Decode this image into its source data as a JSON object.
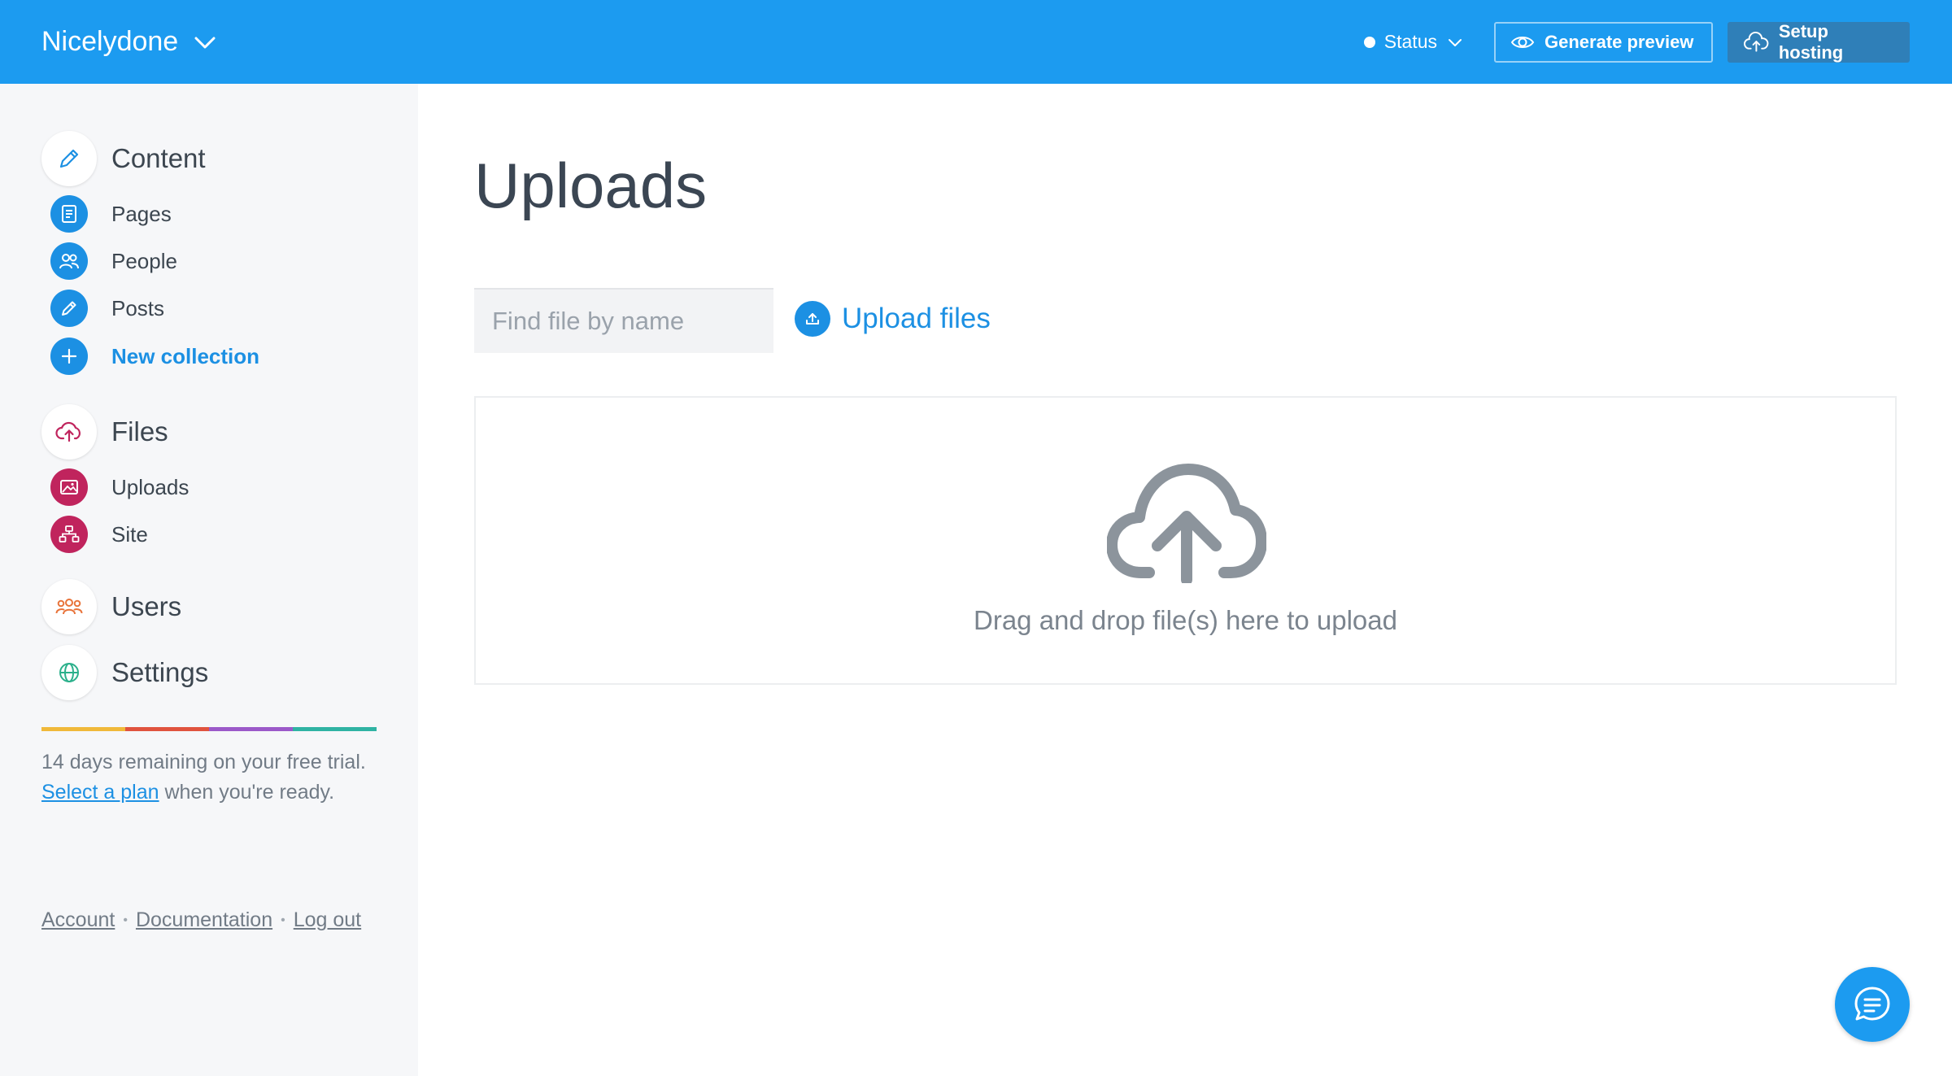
{
  "header": {
    "site_name": "Nicelydone",
    "status_label": "Status",
    "preview_label": "Generate preview",
    "hosting_label": "Setup hosting"
  },
  "sidebar": {
    "content": {
      "label": "Content",
      "items": [
        {
          "label": "Pages",
          "icon": "page-icon"
        },
        {
          "label": "People",
          "icon": "people-icon"
        },
        {
          "label": "Posts",
          "icon": "pencil-icon"
        },
        {
          "label": "New collection",
          "icon": "plus-icon"
        }
      ]
    },
    "files": {
      "label": "Files",
      "items": [
        {
          "label": "Uploads",
          "icon": "image-icon"
        },
        {
          "label": "Site",
          "icon": "sitemap-icon"
        }
      ]
    },
    "users_label": "Users",
    "settings_label": "Settings",
    "trial_text": "14 days remaining on your free trial.",
    "select_plan_link": "Select a plan",
    "ready_text": "when you're ready.",
    "footer_links": [
      "Account",
      "Documentation",
      "Log out"
    ],
    "colors": {
      "accent": "#1c90e3",
      "files": "#c0245d",
      "users": "#e8733a",
      "settings": "#2bb08b",
      "rainbow": [
        "#f0b93a",
        "#e0533e",
        "#9b59c9",
        "#2fb3a3"
      ]
    }
  },
  "main": {
    "title": "Uploads",
    "search_placeholder": "Find file by name",
    "upload_label": "Upload files",
    "dropzone_text": "Drag and drop file(s) here to upload"
  }
}
